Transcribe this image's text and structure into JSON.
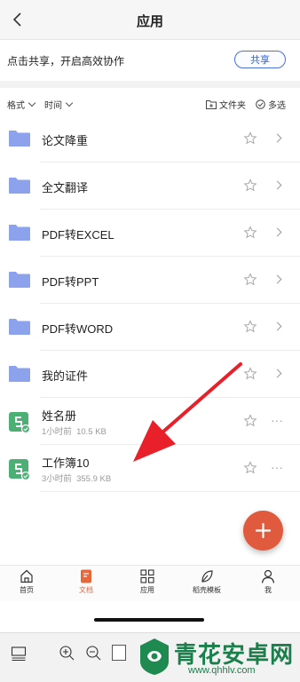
{
  "header": {
    "title": "应用"
  },
  "share": {
    "text": "点击共享，开启高效协作",
    "button": "共享"
  },
  "filters": {
    "format": "格式",
    "time": "时间",
    "folder": "文件夹",
    "multi": "多选"
  },
  "folders": [
    {
      "name": "论文降重"
    },
    {
      "name": "全文翻译"
    },
    {
      "name": "PDF转EXCEL"
    },
    {
      "name": "PDF转PPT"
    },
    {
      "name": "PDF转WORD"
    },
    {
      "name": "我的证件"
    }
  ],
  "files": [
    {
      "name": "姓名册",
      "time": "1小时前",
      "size": "10.5 KB"
    },
    {
      "name": "工作簿10",
      "time": "3小时前",
      "size": "355.9 KB"
    }
  ],
  "tabs": [
    {
      "label": "首页"
    },
    {
      "label": "文档"
    },
    {
      "label": "应用"
    },
    {
      "label": "稻壳模板"
    },
    {
      "label": "我"
    }
  ],
  "watermark": {
    "name": "青花安卓网",
    "url": "www.qhhlv.com"
  },
  "colors": {
    "accent": "#e05a3e",
    "folder": "#8da2ec",
    "sheet": "#4caf73",
    "link": "#2f5fd0"
  }
}
